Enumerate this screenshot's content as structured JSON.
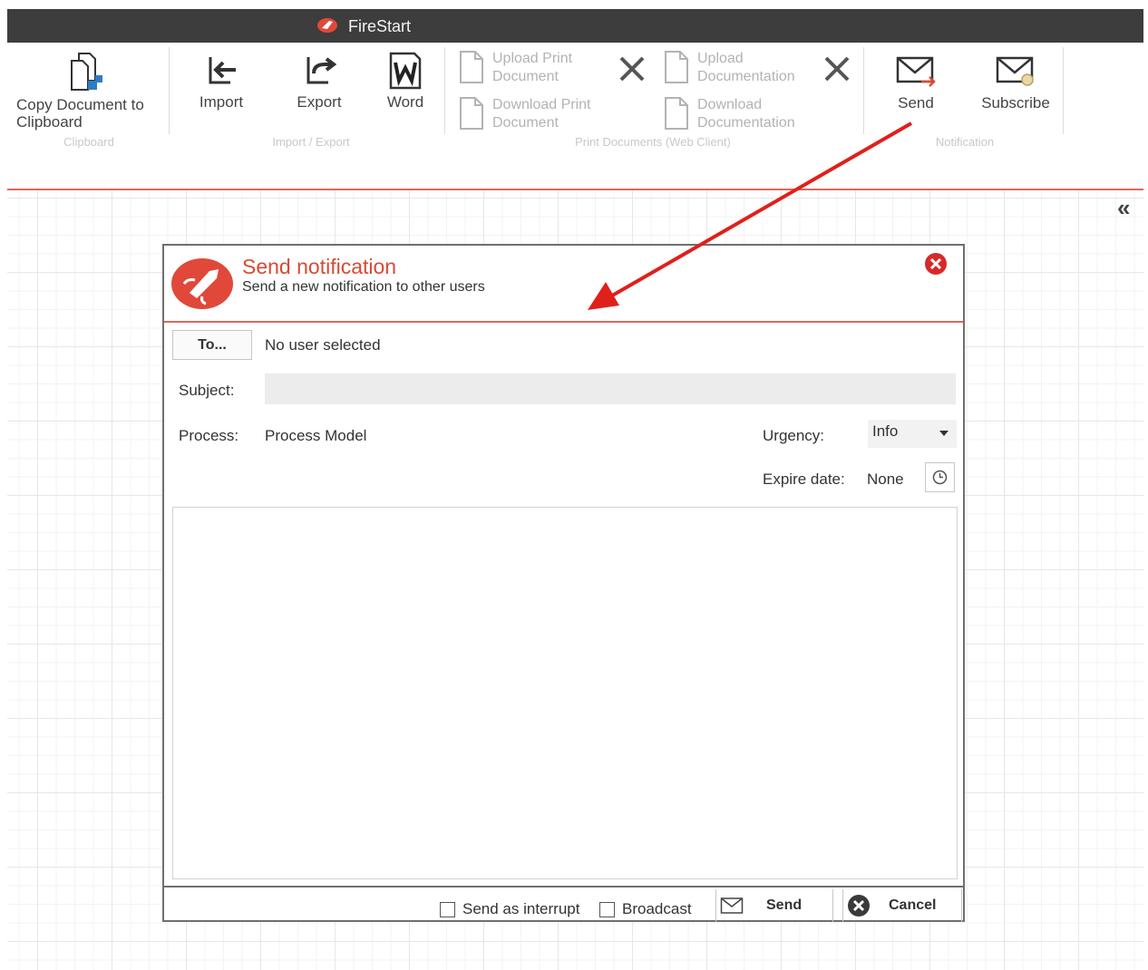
{
  "app": {
    "title": "FireStart"
  },
  "ribbon": {
    "copy_document": "Copy Document to Clipboard",
    "import": "Import",
    "export": "Export",
    "word": "Word",
    "upload_print_document": "Upload Print Document",
    "download_print_document": "Download Print Document",
    "upload_documentation": "Upload Documentation",
    "download_documentation": "Download Documentation",
    "send": "Send",
    "subscribe": "Subscribe",
    "groups": {
      "clipboard": "Clipboard",
      "import_export": "Import / Export",
      "print_documents": "Print Documents (Web Client)",
      "notification": "Notification"
    }
  },
  "canvas": {
    "collapse_glyph": "«"
  },
  "dialog": {
    "title": "Send notification",
    "subtitle": "Send a new notification to other users",
    "to_button": "To...",
    "recipients": "No user selected",
    "subject_label": "Subject:",
    "subject_value": "",
    "process_label": "Process:",
    "process_value": "Process Model",
    "urgency_label": "Urgency:",
    "urgency_value": "Info",
    "expire_label": "Expire date:",
    "expire_value": "None",
    "message_value": "",
    "send_as_interrupt": "Send as interrupt",
    "broadcast": "Broadcast",
    "send_button": "Send",
    "cancel_button": "Cancel"
  },
  "colors": {
    "accent": "#d94a33",
    "titlebar": "#3d3d3d",
    "annotation_arrow": "#e0201b"
  }
}
